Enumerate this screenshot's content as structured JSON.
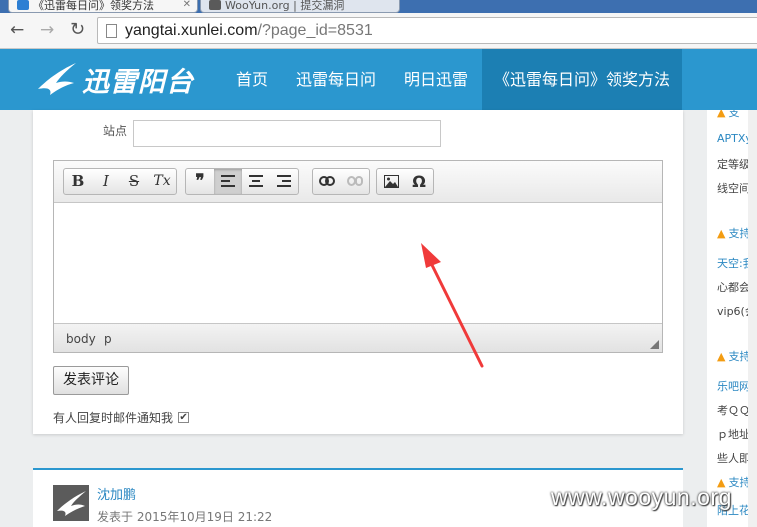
{
  "browser": {
    "tabs": [
      {
        "label": "《迅雷每日问》领奖方法",
        "active": true
      },
      {
        "label": "WooYun.org | 提交漏洞",
        "active": false
      }
    ],
    "url_host": "yangtai.xunlei.com",
    "url_rest": "/?page_id=8531",
    "nav_icons": {
      "back": "back-arrow-icon",
      "forward": "forward-arrow-icon",
      "reload": "reload-icon"
    }
  },
  "site": {
    "logo_text": "迅雷阳台",
    "nav": [
      {
        "label": "首页"
      },
      {
        "label": "迅雷每日问"
      },
      {
        "label": "明日迅雷"
      },
      {
        "label": "《迅雷每日问》领奖方法"
      }
    ],
    "colors": {
      "header": "#2b97cf",
      "nav_active": "#1c7fb3",
      "annotation": "#f03a3a"
    }
  },
  "form": {
    "site_label": "站点",
    "site_value": "",
    "toolbar": {
      "bold": "B",
      "italic": "I",
      "strike": "S",
      "clear_format": "Tx",
      "blockquote": "❞",
      "link_icon": "link-icon",
      "unlink_icon": "unlink-icon",
      "image_icon": "image-icon",
      "special_char": "Ω"
    },
    "path": [
      "body",
      "p"
    ],
    "submit_label": "发表评论",
    "notify_label": "有人回复时邮件通知我",
    "notify_checked": "✔"
  },
  "comment": {
    "author": "沈加鹏",
    "meta": "发表于 2015年10月19日 21:22"
  },
  "sidebar": {
    "lines": [
      {
        "text": "支"
      },
      {
        "text": "APTXyy"
      },
      {
        "text": "定等级后"
      },
      {
        "text": "线空间。"
      },
      {
        "text": "支持"
      },
      {
        "text": "天空:我"
      },
      {
        "text": "心都会显"
      },
      {
        "text": "vip6(会"
      },
      {
        "text": "支持"
      },
      {
        "text": "乐吧网:"
      },
      {
        "text": "考ＱＱ同"
      },
      {
        "text": "ｐ地址,"
      },
      {
        "text": "些人即使"
      },
      {
        "text": "支持"
      },
      {
        "text": "陌上花开"
      }
    ]
  },
  "watermark": "www.wooyun.org"
}
